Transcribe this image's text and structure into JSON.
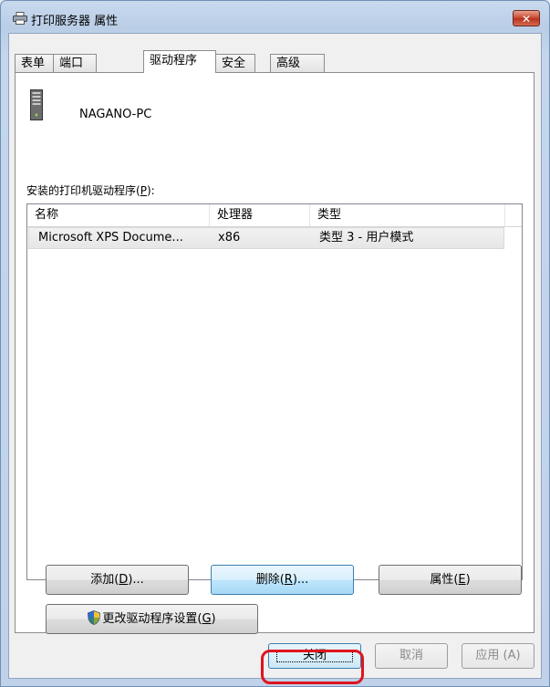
{
  "window": {
    "title": "打印服务器 属性",
    "close_glyph": "✕",
    "accent_color": "#b8321d"
  },
  "tabs": [
    {
      "label": "表单"
    },
    {
      "label": "端口"
    },
    {
      "label": "驱动程序",
      "active": true
    },
    {
      "label": "安全"
    },
    {
      "label": "高级"
    }
  ],
  "server": {
    "name": "NAGANO-PC",
    "icon": "server-tower-icon"
  },
  "drivers": {
    "label_prefix": "安装的打印机驱动程序(",
    "label_key": "P",
    "label_suffix": "):",
    "columns": [
      "名称",
      "处理器",
      "类型"
    ],
    "rows": [
      {
        "name": "Microsoft XPS Docume...",
        "processor": "x86",
        "type": "类型 3 - 用户模式"
      }
    ]
  },
  "buttons": {
    "add": {
      "prefix": "添加(",
      "key": "D",
      "suffix": ")..."
    },
    "remove": {
      "prefix": "删除(",
      "key": "R",
      "suffix": ")..."
    },
    "properties": {
      "prefix": "属性(",
      "key": "E",
      "suffix": ")"
    },
    "change_settings": {
      "prefix": "更改驱动程序设置(",
      "key": "G",
      "suffix": ")"
    }
  },
  "footer": {
    "close": "关闭",
    "cancel": "取消",
    "apply": "应用 (A)"
  },
  "highlight_color": "#e0141e"
}
